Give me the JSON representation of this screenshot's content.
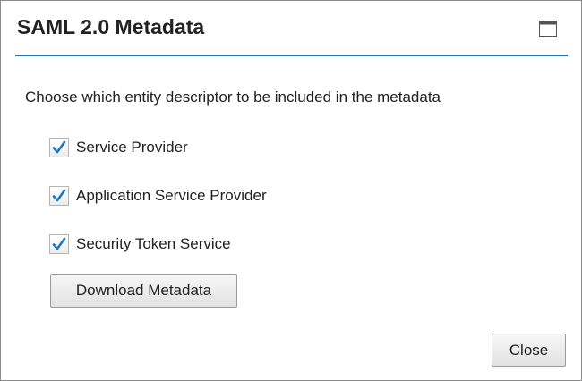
{
  "dialog": {
    "title": "SAML 2.0 Metadata",
    "maximize_icon": "window-maximize-icon",
    "intro": "Choose which entity descriptor to be included in the metadata",
    "options": [
      {
        "label": "Service Provider",
        "checked": true
      },
      {
        "label": "Application Service Provider",
        "checked": true
      },
      {
        "label": "Security Token Service",
        "checked": true
      }
    ],
    "download_label": "Download Metadata",
    "close_label": "Close"
  },
  "colors": {
    "accent": "#1f7ac2",
    "checkmark": "#1a78c2",
    "border": "#8c8c8c"
  }
}
